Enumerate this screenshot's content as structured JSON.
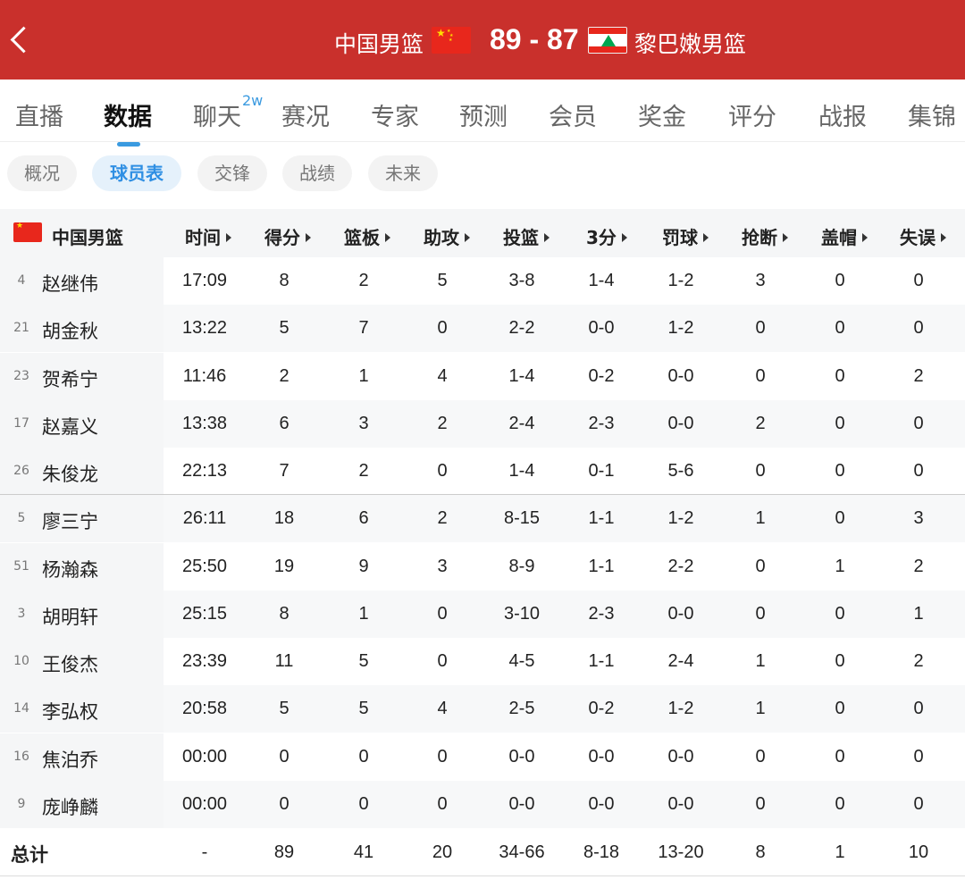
{
  "header": {
    "home_team": "中国男篮",
    "away_team": "黎巴嫩男篮",
    "score": "89 - 87"
  },
  "tabs": [
    {
      "label": "直播"
    },
    {
      "label": "数据",
      "active": true
    },
    {
      "label": "聊天",
      "badge": "2w"
    },
    {
      "label": "赛况"
    },
    {
      "label": "专家"
    },
    {
      "label": "预测"
    },
    {
      "label": "会员"
    },
    {
      "label": "奖金"
    },
    {
      "label": "评分"
    },
    {
      "label": "战报"
    },
    {
      "label": "集锦"
    }
  ],
  "subtabs": [
    {
      "label": "概况"
    },
    {
      "label": "球员表",
      "active": true
    },
    {
      "label": "交锋"
    },
    {
      "label": "战绩"
    },
    {
      "label": "未来"
    }
  ],
  "table": {
    "team_label": "中国男篮",
    "columns": [
      "时间",
      "得分",
      "篮板",
      "助攻",
      "投篮",
      "3分",
      "罚球",
      "抢断",
      "盖帽",
      "失误"
    ],
    "players": [
      {
        "num": "4",
        "name": "赵继伟",
        "stats": [
          "17:09",
          "8",
          "2",
          "5",
          "3-8",
          "1-4",
          "1-2",
          "3",
          "0",
          "0"
        ]
      },
      {
        "num": "21",
        "name": "胡金秋",
        "stats": [
          "13:22",
          "5",
          "7",
          "0",
          "2-2",
          "0-0",
          "1-2",
          "0",
          "0",
          "0"
        ]
      },
      {
        "num": "23",
        "name": "贺希宁",
        "stats": [
          "11:46",
          "2",
          "1",
          "4",
          "1-4",
          "0-2",
          "0-0",
          "0",
          "0",
          "2"
        ]
      },
      {
        "num": "17",
        "name": "赵嘉义",
        "stats": [
          "13:38",
          "6",
          "3",
          "2",
          "2-4",
          "2-3",
          "0-0",
          "2",
          "0",
          "0"
        ]
      },
      {
        "num": "26",
        "name": "朱俊龙",
        "stats": [
          "22:13",
          "7",
          "2",
          "0",
          "1-4",
          "0-1",
          "5-6",
          "0",
          "0",
          "0"
        ]
      },
      {
        "num": "5",
        "name": "廖三宁",
        "stats": [
          "26:11",
          "18",
          "6",
          "2",
          "8-15",
          "1-1",
          "1-2",
          "1",
          "0",
          "3"
        ]
      },
      {
        "num": "51",
        "name": "杨瀚森",
        "stats": [
          "25:50",
          "19",
          "9",
          "3",
          "8-9",
          "1-1",
          "2-2",
          "0",
          "1",
          "2"
        ]
      },
      {
        "num": "3",
        "name": "胡明轩",
        "stats": [
          "25:15",
          "8",
          "1",
          "0",
          "3-10",
          "2-3",
          "0-0",
          "0",
          "0",
          "1"
        ]
      },
      {
        "num": "10",
        "name": "王俊杰",
        "stats": [
          "23:39",
          "11",
          "5",
          "0",
          "4-5",
          "1-1",
          "2-4",
          "1",
          "0",
          "2"
        ]
      },
      {
        "num": "14",
        "name": "李弘权",
        "stats": [
          "20:58",
          "5",
          "5",
          "4",
          "2-5",
          "0-2",
          "1-2",
          "1",
          "0",
          "0"
        ]
      },
      {
        "num": "16",
        "name": "焦泊乔",
        "stats": [
          "00:00",
          "0",
          "0",
          "0",
          "0-0",
          "0-0",
          "0-0",
          "0",
          "0",
          "0"
        ]
      },
      {
        "num": "9",
        "name": "庞峥麟",
        "stats": [
          "00:00",
          "0",
          "0",
          "0",
          "0-0",
          "0-0",
          "0-0",
          "0",
          "0",
          "0"
        ]
      }
    ],
    "total": {
      "label": "总计",
      "stats": [
        "-",
        "89",
        "41",
        "20",
        "34-66",
        "8-18",
        "13-20",
        "8",
        "1",
        "10"
      ]
    }
  },
  "colors": {
    "header_bg": "#c9302c",
    "accent": "#3a9ae0"
  }
}
